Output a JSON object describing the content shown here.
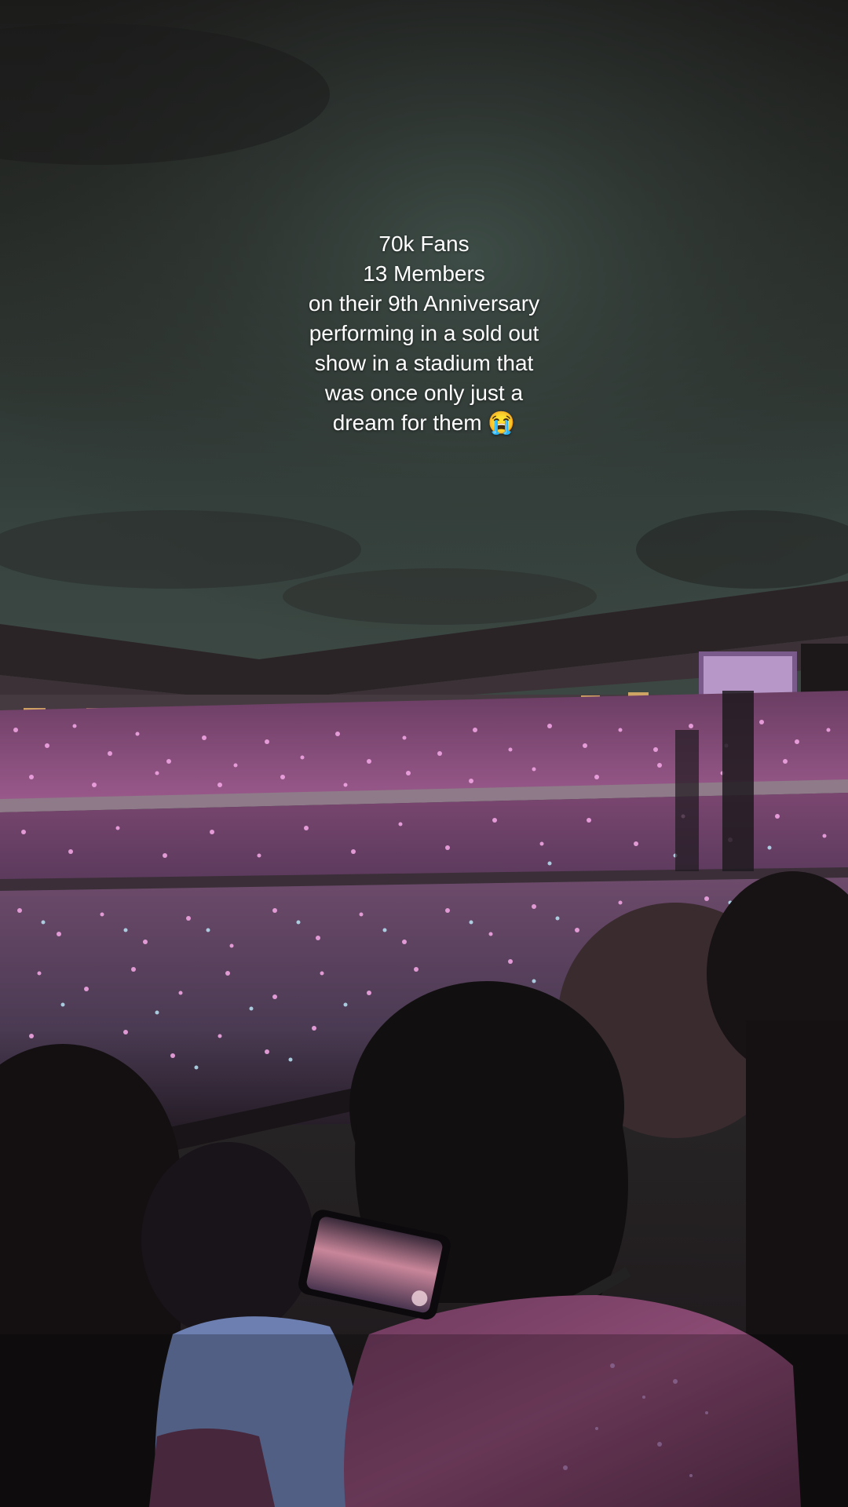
{
  "caption": {
    "lines": [
      "70k Fans",
      "13 Members",
      "on their 9th Anniversary",
      "performing in a sold out",
      "show in a stadium that",
      "was once only just a",
      "dream for them 😭"
    ]
  },
  "scene": {
    "description_icon": "stadium-crowd-photo",
    "colors": {
      "lightstick_pink": "#e08ad0",
      "lightstick_cyan": "#a9d8f0",
      "sky_teal": "#3b4742",
      "roof": "#2a2426"
    }
  }
}
